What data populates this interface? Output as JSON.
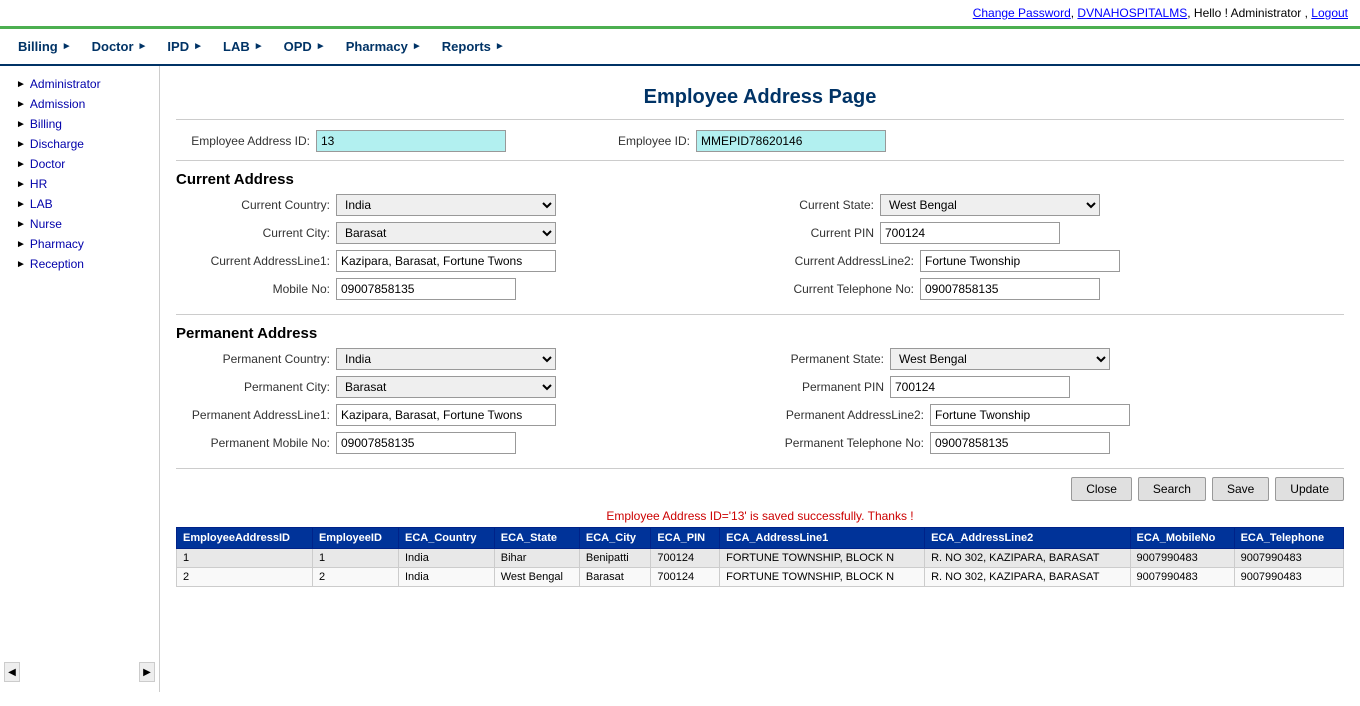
{
  "topbar": {
    "change_password": "Change Password",
    "app_name": "DVNAHOSPITALMS",
    "hello": "Hello ! Administrator ,",
    "logout": "Logout"
  },
  "nav": {
    "items": [
      {
        "label": "Billing",
        "id": "billing"
      },
      {
        "label": "Doctor",
        "id": "doctor"
      },
      {
        "label": "IPD",
        "id": "ipd"
      },
      {
        "label": "LAB",
        "id": "lab"
      },
      {
        "label": "OPD",
        "id": "opd"
      },
      {
        "label": "Pharmacy",
        "id": "pharmacy"
      },
      {
        "label": "Reports",
        "id": "reports"
      }
    ]
  },
  "sidebar": {
    "items": [
      {
        "label": "Administrator",
        "id": "administrator"
      },
      {
        "label": "Admission",
        "id": "admission"
      },
      {
        "label": "Billing",
        "id": "billing"
      },
      {
        "label": "Discharge",
        "id": "discharge"
      },
      {
        "label": "Doctor",
        "id": "doctor"
      },
      {
        "label": "HR",
        "id": "hr"
      },
      {
        "label": "LAB",
        "id": "lab"
      },
      {
        "label": "Nurse",
        "id": "nurse"
      },
      {
        "label": "Pharmacy",
        "id": "pharmacy"
      },
      {
        "label": "Reception",
        "id": "reception"
      }
    ]
  },
  "page": {
    "title": "Employee Address Page"
  },
  "form": {
    "employee_address_id_label": "Employee Address ID:",
    "employee_address_id_value": "13",
    "employee_id_label": "Employee ID:",
    "employee_id_value": "MMEPID78620146",
    "current_address_heading": "Current Address",
    "current_country_label": "Current Country:",
    "current_country_value": "India",
    "current_state_label": "Current State:",
    "current_state_value": "West Bengal",
    "current_city_label": "Current City:",
    "current_city_value": "Barasat",
    "current_pin_label": "Current PIN",
    "current_pin_value": "700124",
    "current_addressline1_label": "Current AddressLine1:",
    "current_addressline1_value": "Kazipara, Barasat, Fortune Twons",
    "current_addressline2_label": "Current AddressLine2:",
    "current_addressline2_value": "Fortune Twonship",
    "mobile_no_label": "Mobile No:",
    "mobile_no_value": "09007858135",
    "current_telephone_label": "Current Telephone No:",
    "current_telephone_value": "09007858135",
    "permanent_address_heading": "Permanent Address",
    "permanent_country_label": "Permanent Country:",
    "permanent_country_value": "India",
    "permanent_state_label": "Permanent State:",
    "permanent_state_value": "West Bengal",
    "permanent_city_label": "Permanent City:",
    "permanent_city_value": "Barasat",
    "permanent_pin_label": "Permanent PIN",
    "permanent_pin_value": "700124",
    "permanent_addressline1_label": "Permanent AddressLine1:",
    "permanent_addressline1_value": "Kazipara, Barasat, Fortune Twons",
    "permanent_addressline2_label": "Permanent AddressLine2:",
    "permanent_addressline2_value": "Fortune Twonship",
    "permanent_mobile_label": "Permanent Mobile No:",
    "permanent_mobile_value": "09007858135",
    "permanent_telephone_label": "Permanent Telephone No:",
    "permanent_telephone_value": "09007858135"
  },
  "buttons": {
    "close": "Close",
    "search": "Search",
    "save": "Save",
    "update": "Update"
  },
  "success_message": "Employee Address ID='13' is saved successfully. Thanks !",
  "table": {
    "columns": [
      "EmployeeAddressID",
      "EmployeeID",
      "ECA_Country",
      "ECA_State",
      "ECA_City",
      "ECA_PIN",
      "ECA_AddressLine1",
      "ECA_AddressLine2",
      "ECA_MobileNo",
      "ECA_Telephone"
    ],
    "rows": [
      {
        "id": "1",
        "emp_id": "1",
        "country": "India",
        "state": "Bihar",
        "city": "Benipatti",
        "pin": "700124",
        "addr1": "FORTUNE TOWNSHIP, BLOCK N",
        "addr2": "R. NO 302, KAZIPARA, BARASAT",
        "mobile": "9007990483",
        "telephone": "9007990483"
      },
      {
        "id": "2",
        "emp_id": "2",
        "country": "India",
        "state": "West Bengal",
        "city": "Barasat",
        "pin": "700124",
        "addr1": "FORTUNE TOWNSHIP, BLOCK N",
        "addr2": "R. NO 302, KAZIPARA, BARASAT",
        "mobile": "9007990483",
        "telephone": "9007990483"
      }
    ]
  },
  "country_options": [
    "India"
  ],
  "state_options": [
    "West Bengal"
  ],
  "city_options": [
    "Barasat"
  ]
}
